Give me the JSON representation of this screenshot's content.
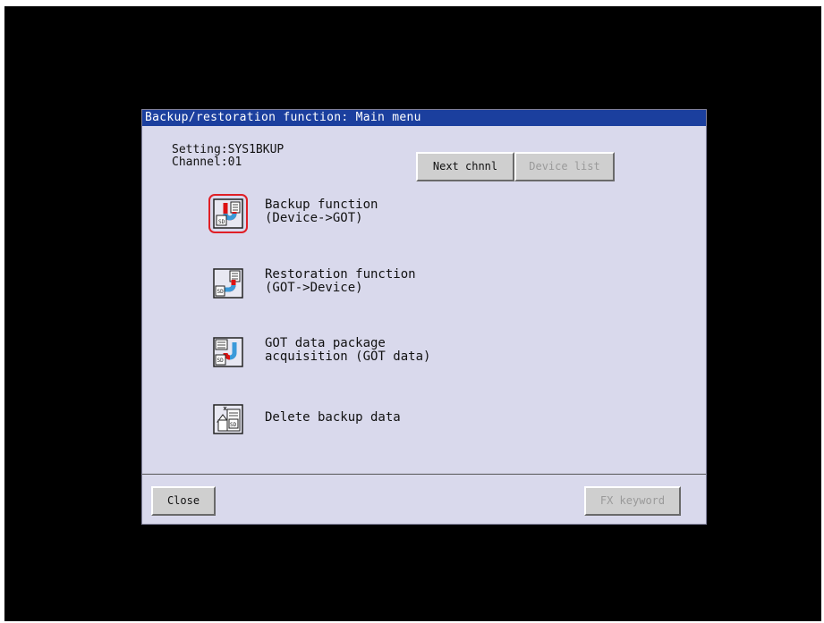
{
  "dialog": {
    "title": "Backup/restoration function: Main menu",
    "setting_line": "Setting:SYS1BKUP",
    "channel_line": "Channel:01"
  },
  "header_buttons": {
    "next_channel": "Next chnnl",
    "device_list": "Device list"
  },
  "menu": [
    {
      "line1": "Backup function",
      "line2": "(Device->GOT)",
      "icon": "backup-icon",
      "selected": true
    },
    {
      "line1": "Restoration function",
      "line2": "(GOT->Device)",
      "icon": "restoration-icon",
      "selected": false
    },
    {
      "line1": "GOT data package",
      "line2": "acquisition (GOT data)",
      "icon": "data-package-icon",
      "selected": false
    },
    {
      "line1": "Delete backup data",
      "line2": "",
      "icon": "delete-backup-icon",
      "selected": false
    }
  ],
  "footer": {
    "close": "Close",
    "fx_keyword": "FX keyword"
  },
  "colors": {
    "titlebar": "#1b3f9e",
    "dialog_bg": "#d9d9ec",
    "selection_outline": "#e01f26"
  }
}
